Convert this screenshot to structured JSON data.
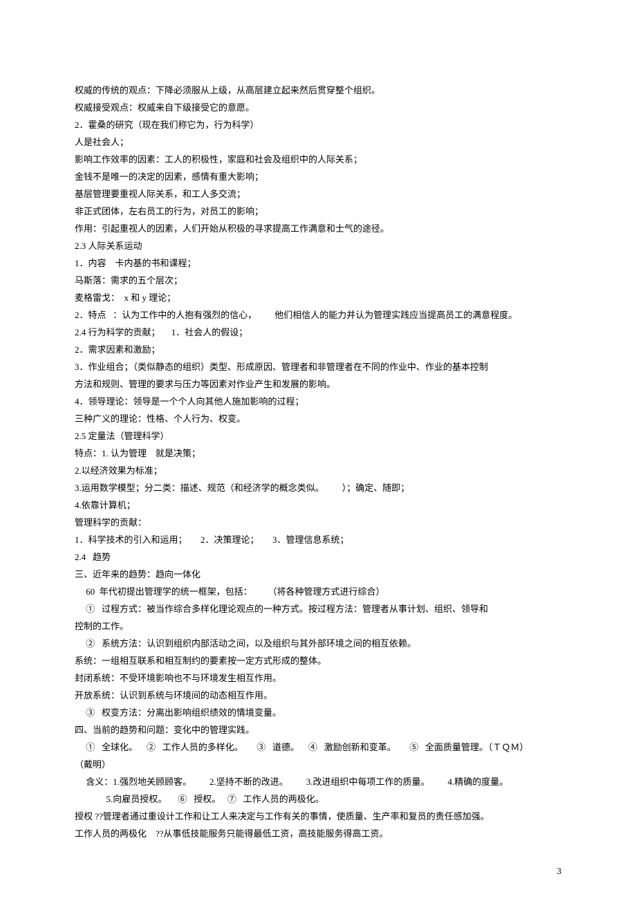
{
  "lines": [
    "权威的传统的观点：下降必须服从上级，从高层建立起来然后贯穿整个组织。",
    "权威接受观点：权威来自下级接受它的意愿。",
    "2．霍桑的研究（现在我们称它为，行为科学）",
    "人是社会人；",
    "影响工作效率的因素：工人的积极性，家庭和社会及组织中的人际关系；",
    "金钱不是唯一的决定的因素，感情有重大影响；",
    "基层管理要重视人际关系，和工人多交流；",
    "非正式团体，左右员工的行为，对员工的影响；",
    "作用：引起重视人的因素，人们开始从积极的寻求提高工作满意和士气的途径。",
    "2.3 人际关系运动",
    "1．内容    卡内基的书和课程；",
    "马斯落：需求的五个层次；",
    "麦格雷戈：  x 和 y 理论；",
    "2．特点   ：认为工作中的人抱有强烈的信心，        他们相信人的能力并认为管理实践应当提高员工的满意程度。",
    "2.4 行为科学的贡献；     1．社会人的假设；",
    "2．需求因素和激励；",
    "3．作业组合；（类似静态的组织）类型、形成原因、管理者和非管理者在不同的作业中、作业的基本控制",
    "方法和规则、管理的要求与压力等因素对作业产生和发展的影响。",
    "4．领导理论：领导是一个个人向其他人施加影响的过程；",
    "三种广义的理论：性格、个人行为、权变。",
    "2.5 定量法（管理科学）",
    "特点：1. 认为管理    就是决策；",
    "2.以经济效果为标准；",
    "3.运用数学模型；分二类：描述、规范（和经济学的概念类似。        ）；确定、随即；",
    "4.依靠计算机；",
    "管理科学的贡献：",
    "1．科学技术的引入和运用；      2．决策理论；      3．管理信息系统；",
    "2.4   趋势",
    "三、近年来的趋势：趋向一体化",
    "     60  年代初提出管理学的统一框架，包括：       （将各种管理方式进行综合）",
    "     ①   过程方式：被当作综合多样化理论观点的一种方式。按过程方法：管理者从事计划、组织、领导和",
    "控制的工作。",
    "     ②   系统方法：认识到组织内部活动之间，以及组织与其外部环境之间的相互依赖。",
    "系统：一组相互联系和相互制约的要素按一定方式形成的整体。",
    "封闭系统：不受环境影响也不与环境发生相互作用。",
    "开放系统：认识到系统与环境间的动态相互作用。",
    "     ③   权变方法：分离出影响组织绩效的情境变量。",
    "四、当前的趋势和问题：变化中的管理实践。",
    "     ①   全球化。    ②   工作人员的多样化。      ③   道德。    ④   激励创新和变革。      ⑤   全面质量管理。（ＴＱＭ）",
    "（戴明）",
    "     含义：1.强烈地关顾顾客。        2.坚持不断的改进。        3.改进组织中每项工作的质量。        4.精确的度量。",
    "              5.向雇员授权。     ⑥   授权。   ⑦   工作人员的两极化。",
    "授权 ??管理者通过重设计工作和让工人来决定与工作有关的事情，使质量、生产率和复员的责任感加强。",
    "工作人员的两极化    ??从事低技能服务只能得最低工资，高技能服务得高工资。"
  ],
  "pageNumber": "3"
}
